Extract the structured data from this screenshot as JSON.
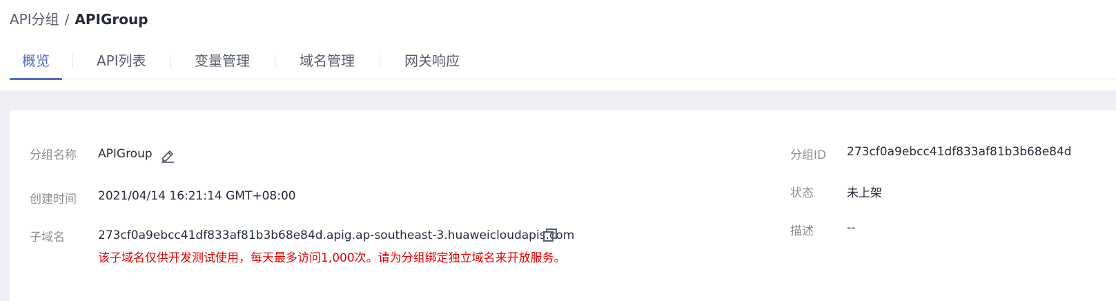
{
  "breadcrumb": {
    "parent": "API分组",
    "separator": "/",
    "current": "APIGroup"
  },
  "tabs": [
    {
      "label": "概览",
      "active": true
    },
    {
      "label": "API列表",
      "active": false
    },
    {
      "label": "变量管理",
      "active": false
    },
    {
      "label": "域名管理",
      "active": false
    },
    {
      "label": "网关响应",
      "active": false
    }
  ],
  "details": {
    "group_name": {
      "label": "分组名称",
      "value": "APIGroup",
      "action_icon": "edit-icon"
    },
    "created_time": {
      "label": "创建时间",
      "value": "2021/04/14 16:21:14 GMT+08:00"
    },
    "subdomain": {
      "label": "子域名",
      "value": "273cf0a9ebcc41df833af81b3b68e84d.apig.ap-southeast-3.huaweicloudapis.com",
      "action_icon": "copy-icon",
      "warning": "该子域名仅供开发测试使用，每天最多访问1,000次。请为分组绑定独立域名来开放服务。"
    },
    "group_id": {
      "label": "分组ID",
      "value": "273cf0a9ebcc41df833af81b3b68e84d"
    },
    "status": {
      "label": "状态",
      "value": "未上架"
    },
    "description": {
      "label": "描述",
      "value": "--"
    }
  },
  "colors": {
    "accent": "#526ecc",
    "warning": "#e60000",
    "label": "#8a8e99",
    "text": "#252b3a",
    "background_band": "#eef0f5"
  }
}
